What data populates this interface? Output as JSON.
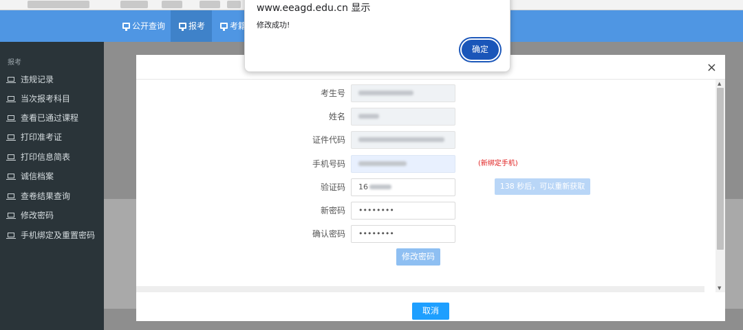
{
  "nav": {
    "items": [
      {
        "label": "公开查询"
      },
      {
        "label": "报考"
      },
      {
        "label": "考籍"
      }
    ]
  },
  "sidebar": {
    "section": "报考",
    "items": [
      {
        "label": "违规记录"
      },
      {
        "label": "当次报考科目"
      },
      {
        "label": "查看已通过课程"
      },
      {
        "label": "打印准考证"
      },
      {
        "label": "打印信息简表"
      },
      {
        "label": "诚信档案"
      },
      {
        "label": "查卷结果查询"
      },
      {
        "label": "修改密码"
      },
      {
        "label": "手机绑定及重置密码"
      }
    ]
  },
  "form": {
    "exam_no_label": "考生号",
    "name_label": "姓名",
    "id_code_label": "证件代码",
    "phone_label": "手机号码",
    "phone_hint": "(新绑定手机)",
    "code_label": "验证码",
    "code_value": "16",
    "resend_label": "138 秒后，可以重新获取",
    "new_pwd_label": "新密码",
    "new_pwd_value": "••••••••",
    "confirm_pwd_label": "确认密码",
    "confirm_pwd_value": "••••••••",
    "submit_label": "修改密码"
  },
  "modal": {
    "close_icon": "×",
    "cancel_label": "取消"
  },
  "alert": {
    "origin": "www.eeagd.edu.cn 显示",
    "message": "修改成功!",
    "ok_label": "确定"
  },
  "colors": {
    "nav": "#4f96e3",
    "sidebar": "#2a3439",
    "primary_button": "#1e9fff",
    "hint_red": "#e02020",
    "alert_button": "#1a56b9"
  }
}
